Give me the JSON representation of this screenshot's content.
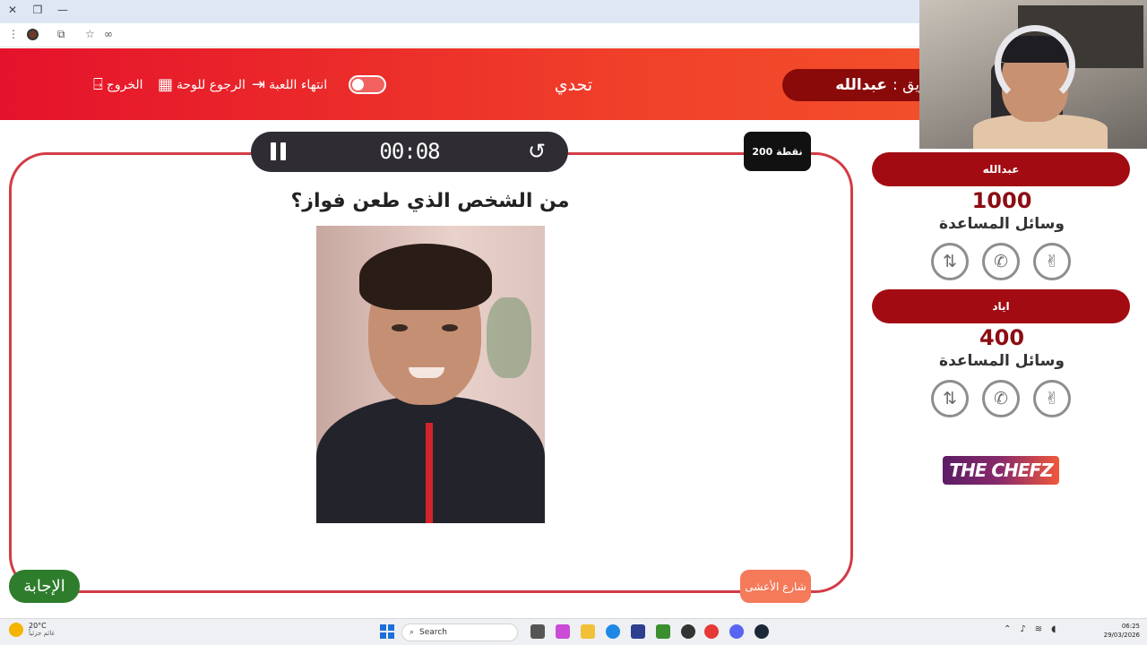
{
  "header": {
    "title": "تحدي",
    "exit_label": "الخروج",
    "back_to_board_label": "الرجوع للوحة",
    "end_game_label": "انتهاء اللعبة",
    "turn_prefix": "دور فريق :",
    "turn_team": "عبدالله"
  },
  "timer": {
    "time": "00:08"
  },
  "question": {
    "points": "200 نقطة",
    "text": "من الشخص الذي طعن فواز؟",
    "answer_label": "الإجابة",
    "category_label": "شارع الأعشى"
  },
  "teams": [
    {
      "name": "عبدالله",
      "score": "1000",
      "aids_label": "وسائل المساعدة"
    },
    {
      "name": "اياد",
      "score": "400",
      "aids_label": "وسائل المساعدة"
    }
  ],
  "logo": {
    "text": "THE CHEFZ"
  },
  "taskbar": {
    "weather_temp": "20°C",
    "weather_desc": "غائم جزئياً",
    "search_placeholder": "Search",
    "time": "06:25",
    "date": "29/03/2026"
  },
  "colors": {
    "header_start": "#e5122b",
    "header_end": "#f55a2c",
    "card_border": "#d23c47",
    "team_pill": "#a30b12",
    "answer_button": "#2e7d2c",
    "category_button": "#f47a5a"
  }
}
